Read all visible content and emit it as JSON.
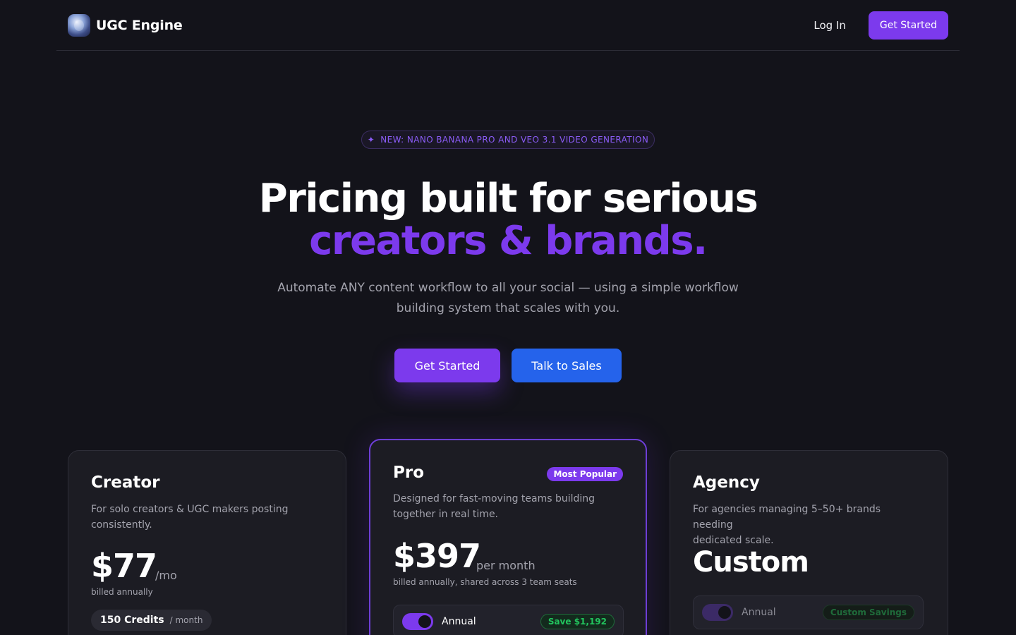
{
  "nav": {
    "brand": "UGC Engine",
    "login": "Log In",
    "cta": "Get Started"
  },
  "hero": {
    "badge": "NEW: NANO BANANA PRO AND VEO 3.1 VIDEO GENERATION",
    "title_line1": "Pricing built for serious",
    "title_line2": "creators & brands.",
    "subtitle_line1": "Automate ANY content workflow to all your social — using a simple workflow",
    "subtitle_line2": "building system that scales with you.",
    "primary_cta": "Get Started",
    "secondary_cta": "Talk to Sales"
  },
  "plans": [
    {
      "name": "Creator",
      "desc_line1": "For solo creators & UGC makers posting",
      "desc_line2": "consistently.",
      "price": "$77",
      "unit": "/mo",
      "billing": "billed annually",
      "credits": "150 Credits",
      "credits_period": "/ month"
    },
    {
      "name": "Pro",
      "badge": "Most Popular",
      "desc_line1": "Designed for fast-moving teams building",
      "desc_line2": "together in real time.",
      "price": "$397",
      "unit": "per month",
      "billing": "billed annually, shared across 3 team seats",
      "toggle_label": "Annual",
      "save": "Save $1,192"
    },
    {
      "name": "Agency",
      "desc_line1": "For agencies managing 5–50+ brands needing",
      "desc_line2": "dedicated scale.",
      "price": "Custom",
      "toggle_label": "Annual",
      "save": "Custom Savings"
    }
  ],
  "colors": {
    "background": "#13131a",
    "accent": "#7c3aed",
    "secondary": "#2563eb",
    "success": "#22c55e"
  },
  "icons": {
    "badge_icon": "sparkle-icon",
    "logo": "globe-logo"
  }
}
